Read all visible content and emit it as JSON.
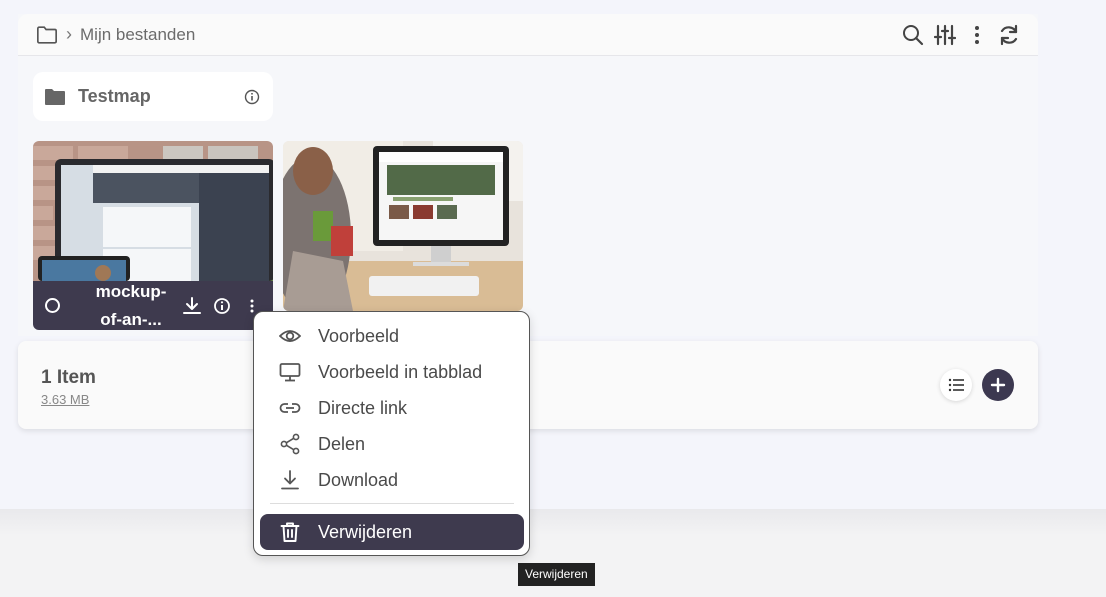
{
  "breadcrumb": {
    "icon": "folder-icon",
    "separator": "›",
    "label": "Mijn bestanden"
  },
  "toolbar_icons": [
    "search-icon",
    "sliders-icon",
    "more-vertical-icon",
    "refresh-icon"
  ],
  "folder": {
    "name": "Testmap",
    "icon": "folder-icon",
    "info_icon": "info-icon"
  },
  "files": [
    {
      "name": "mockup-\nof-an-...",
      "selected": false
    },
    {
      "name": ""
    }
  ],
  "footer": {
    "count": "1 Item",
    "size": "3.63 MB"
  },
  "context_menu": {
    "items": [
      {
        "label": "Voorbeeld",
        "icon": "eye-icon"
      },
      {
        "label": "Voorbeeld in tabblad",
        "icon": "monitor-icon"
      },
      {
        "label": "Directe link",
        "icon": "link-icon"
      },
      {
        "label": "Delen",
        "icon": "share-icon"
      },
      {
        "label": "Download",
        "icon": "download-icon"
      },
      {
        "label": "Verwijderen",
        "icon": "trash-icon"
      }
    ]
  },
  "tooltip": "Verwijderen",
  "colors": {
    "accent": "#3e3a4e",
    "background": "#f4f5fb",
    "text": "#4a4a4a"
  }
}
